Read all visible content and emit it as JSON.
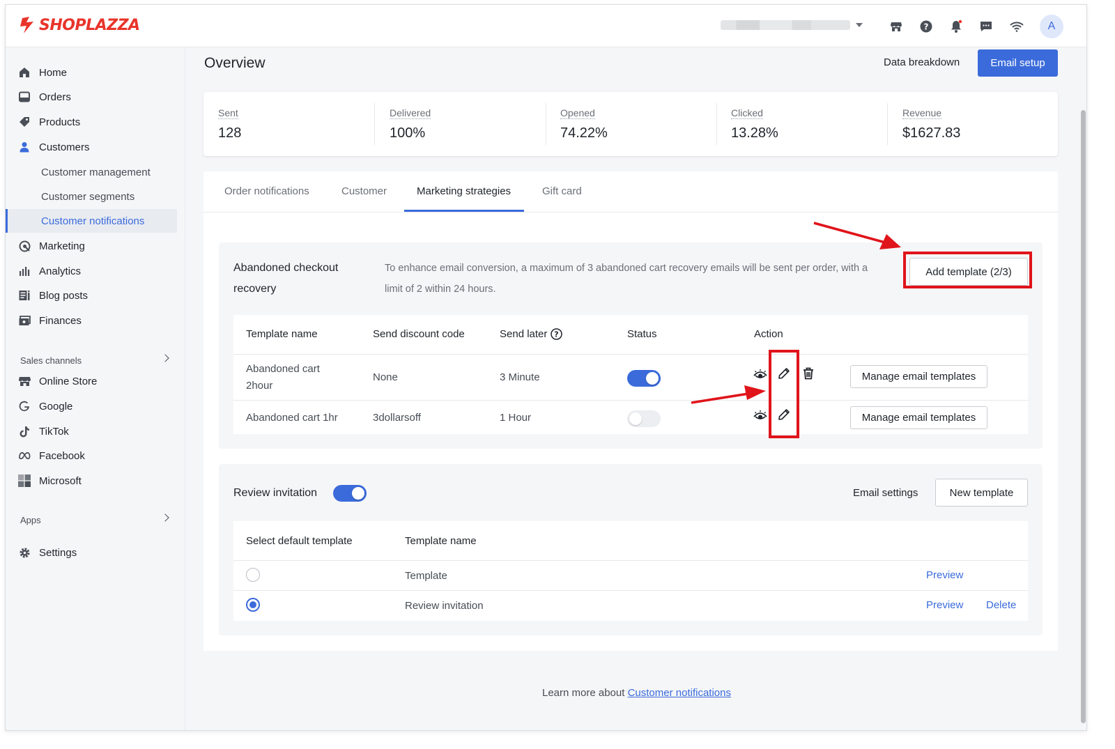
{
  "brand": {
    "name": "SHOPLAZZA",
    "color": "#e8342a",
    "accent": "#3b6bdb"
  },
  "topbar": {
    "avatar_initial": "A",
    "icons": [
      "store-icon",
      "help-icon",
      "bell-icon",
      "chat-icon",
      "wifi-icon"
    ]
  },
  "sidebar": {
    "items": [
      {
        "label": "Home",
        "icon": "home-icon"
      },
      {
        "label": "Orders",
        "icon": "orders-icon"
      },
      {
        "label": "Products",
        "icon": "tag-icon"
      },
      {
        "label": "Customers",
        "icon": "person-icon"
      }
    ],
    "customer_subitems": [
      "Customer management",
      "Customer segments",
      "Customer notifications"
    ],
    "more_items": [
      {
        "label": "Marketing",
        "icon": "marketing-icon"
      },
      {
        "label": "Analytics",
        "icon": "analytics-icon"
      },
      {
        "label": "Blog posts",
        "icon": "blog-icon"
      },
      {
        "label": "Finances",
        "icon": "finances-icon"
      }
    ],
    "sales_channels_label": "Sales channels",
    "channels": [
      {
        "label": "Online Store",
        "icon": "store-icon"
      },
      {
        "label": "Google",
        "icon": "google-icon"
      },
      {
        "label": "TikTok",
        "icon": "tiktok-icon"
      },
      {
        "label": "Facebook",
        "icon": "meta-icon"
      },
      {
        "label": "Microsoft",
        "icon": "microsoft-icon"
      }
    ],
    "apps_label": "Apps",
    "settings_label": "Settings"
  },
  "header": {
    "title": "Overview",
    "data_breakdown": "Data breakdown",
    "email_setup": "Email setup"
  },
  "stats": [
    {
      "label": "Sent",
      "value": "128"
    },
    {
      "label": "Delivered",
      "value": "100%"
    },
    {
      "label": "Opened",
      "value": "74.22%"
    },
    {
      "label": "Clicked",
      "value": "13.28%"
    },
    {
      "label": "Revenue",
      "value": "$1627.83"
    }
  ],
  "tabs": [
    "Order notifications",
    "Customer",
    "Marketing strategies",
    "Gift card"
  ],
  "active_tab": "Marketing strategies",
  "abandoned": {
    "title_line1": "Abandoned checkout",
    "title_line2": "recovery",
    "desc_line1": "To enhance email conversion, a maximum of 3 abandoned cart recovery emails will be sent per order, with a",
    "desc_line2": "limit of 2 within 24 hours.",
    "add_template": "Add template (2/3)",
    "columns": [
      "Template name",
      "Send discount code",
      "Send later",
      "Status",
      "Action"
    ],
    "rows": [
      {
        "name_line1": "Abandoned cart",
        "name_line2": "2hour",
        "discount": "None",
        "send_later": "3 Minute",
        "status_on": true,
        "manage": "Manage email templates"
      },
      {
        "name_line1": "Abandoned cart 1hr",
        "name_line2": "",
        "discount": "3dollarsoff",
        "send_later": "1 Hour",
        "status_on": false,
        "manage": "Manage email templates"
      }
    ]
  },
  "review": {
    "title": "Review invitation",
    "enabled": true,
    "email_settings": "Email settings",
    "new_template": "New template",
    "columns": [
      "Select default template",
      "Template name"
    ],
    "rows": [
      {
        "name": "Template",
        "selected": false,
        "preview": "Preview",
        "delete": ""
      },
      {
        "name": "Review invitation",
        "selected": true,
        "preview": "Preview",
        "delete": "Delete"
      }
    ]
  },
  "footer": {
    "text": "Learn more about",
    "link": "Customer notifications"
  },
  "annotation_color": "#e0141b"
}
